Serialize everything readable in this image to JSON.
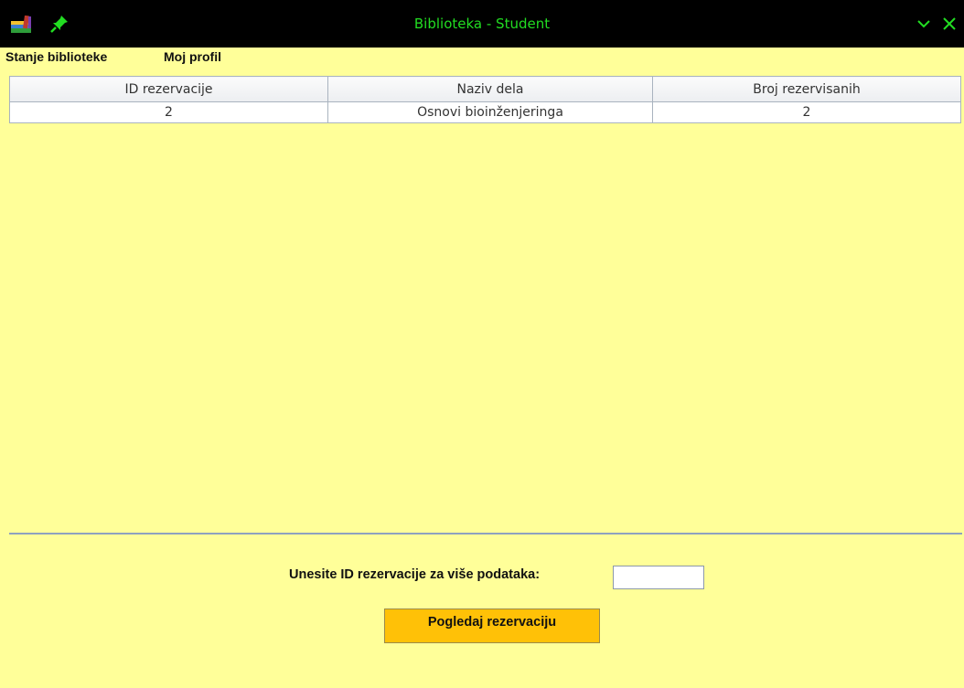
{
  "window": {
    "title": "Biblioteka - Student",
    "title_color": "#22dd22",
    "titlebar_color": "#000000",
    "icons": {
      "app": "books-icon",
      "pin": "pin-icon",
      "minimize": "chevron-down-icon",
      "close": "close-icon"
    }
  },
  "menu": {
    "items": [
      {
        "label": "Stanje biblioteke"
      },
      {
        "label": "Moj profil"
      }
    ]
  },
  "table": {
    "columns": [
      "ID rezervacije",
      "Naziv dela",
      "Broj rezervisanih"
    ],
    "rows": [
      [
        "2",
        "Osnovi bioinženjeringa",
        "2"
      ]
    ]
  },
  "form": {
    "prompt": "Unesite ID rezervacije za više podataka:",
    "input_value": "",
    "button_label": "Pogledaj rezervaciju"
  },
  "colors": {
    "background": "#ffff99",
    "button": "#ffc107"
  }
}
